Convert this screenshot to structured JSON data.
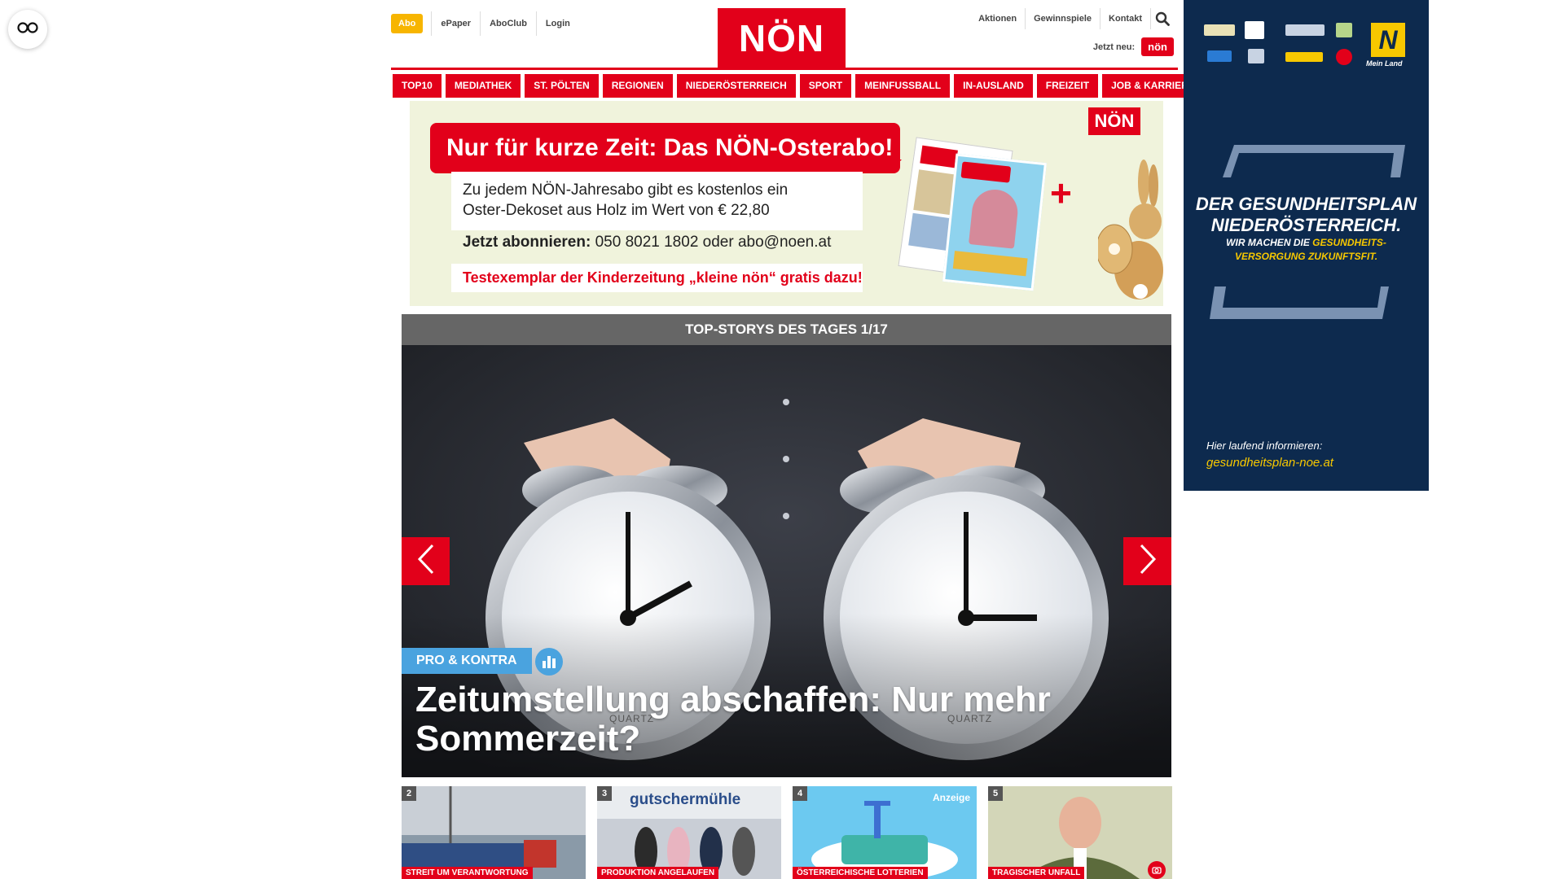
{
  "header": {
    "abo_label": "Abo",
    "left_links": [
      "ePaper",
      "AboClub",
      "Login"
    ],
    "logo_text": "NÖN",
    "right_links": [
      "Aktionen",
      "Gewinnspiele",
      "Kontakt"
    ],
    "jetzt_neu_label": "Jetzt neu:",
    "kleine_logo_text": "nön"
  },
  "nav": {
    "items": [
      "TOP10",
      "MEDIATHEK",
      "ST. PÖLTEN",
      "REGIONEN",
      "NIEDERÖSTERREICH",
      "SPORT",
      "MEINFUSSBALL",
      "IN-AUSLAND",
      "FREIZEIT",
      "JOB & KARRIERE"
    ]
  },
  "ad_banner": {
    "headline": "Nur für kurze Zeit: Das NÖN-Osterabo!",
    "body_line1": "Zu jedem NÖN-Jahresabo gibt es kostenlos ein",
    "body_line2": "Oster-Dekoset aus Holz im Wert von € 22,80",
    "phone_label": "Jetzt abonnieren:",
    "phone_text": "050 8021 1802 oder abo@noen.at",
    "kids_offer": "Testexemplar der Kinderzeitung „kleine nön“ gratis dazu!",
    "logo_text": "NÖN",
    "plus_sign": "+"
  },
  "slider": {
    "header": "TOP-STORYS DES TAGES 1/17",
    "badge": "PRO & KONTRA",
    "title": "Zeitumstellung abschaffen: Nur mehr Sommerzeit?",
    "clock_brand": "QUARTZ"
  },
  "thumbnails": [
    {
      "num": "2",
      "tag": "STREIT UM VERANTWORTUNG",
      "color": "#8a9aa8"
    },
    {
      "num": "3",
      "tag": "PRODUKTION ANGELAUFEN",
      "color": "#c9ced6",
      "sign": "gutschermühle"
    },
    {
      "num": "4",
      "tag": "ÖSTERREICHISCHE LOTTERIEN",
      "color": "#4fb6e6",
      "ad_label": "Anzeige"
    },
    {
      "num": "5",
      "tag": "TRAGISCHER UNFALL",
      "color": "#7d8c5a"
    }
  ],
  "sky_ad": {
    "headline_line1": "DER GESUNDHEITSPLAN",
    "headline_line2": "NIEDERÖSTERREICH.",
    "sub_line1_a": "WIR MACHEN DIE ",
    "sub_line1_b": "GESUNDHEITS-",
    "sub_line2": "VERSORGUNG ZUKUNFTSFIT.",
    "info": "Hier laufend informieren:",
    "url": "gesundheitsplan-noe.at",
    "meinland": "Mein Land",
    "n_logo": "N"
  },
  "colors": {
    "brand_red": "#e2001a",
    "abo_yellow": "#f7b500",
    "badge_blue": "#4aa3df",
    "sky_navy": "#0d2a4e",
    "sky_yellow": "#f7c800"
  }
}
